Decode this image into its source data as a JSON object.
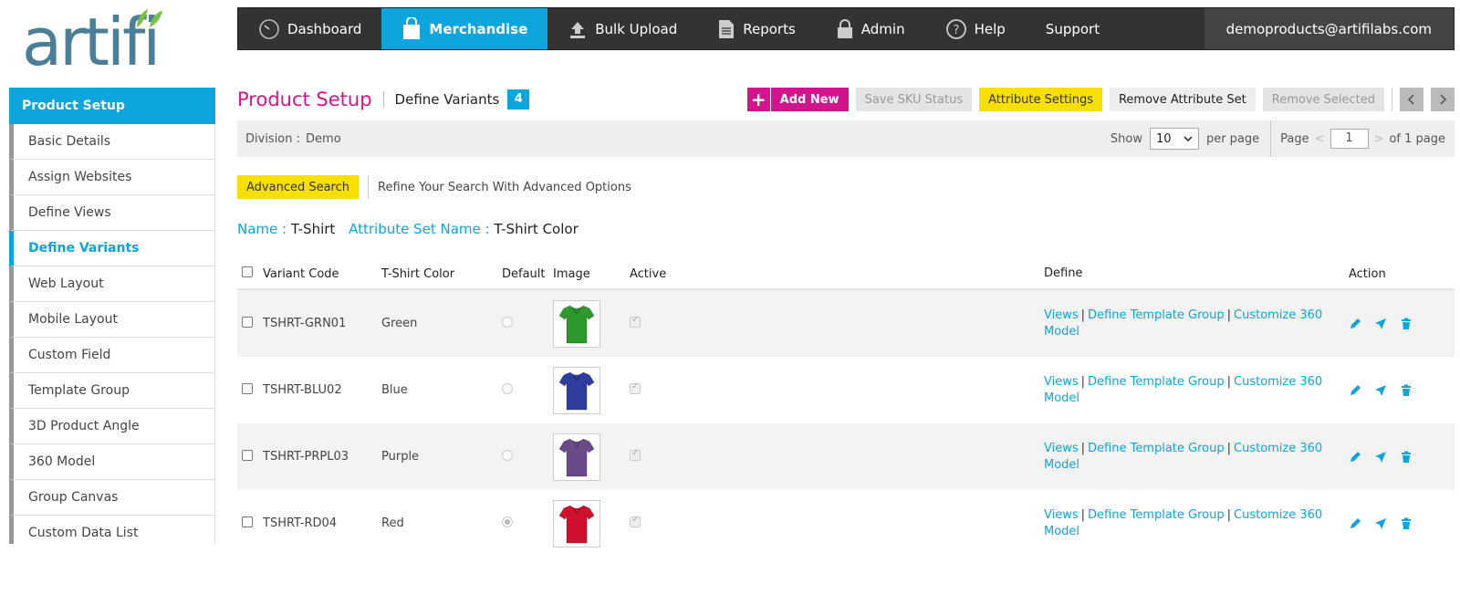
{
  "logo": {
    "text": "artifi"
  },
  "topnav": {
    "items": [
      {
        "label": "Dashboard",
        "icon": "gauge-icon"
      },
      {
        "label": "Merchandise",
        "icon": "shopping-bag-icon",
        "active": true
      },
      {
        "label": "Bulk Upload",
        "icon": "upload-icon"
      },
      {
        "label": "Reports",
        "icon": "document-icon"
      },
      {
        "label": "Admin",
        "icon": "lock-icon"
      },
      {
        "label": "Help",
        "icon": "help-circle-icon"
      },
      {
        "label": "Support",
        "icon": ""
      }
    ],
    "user": "demoproducts@artifilabs.com"
  },
  "sidebar": {
    "header": "Product Setup",
    "items": [
      {
        "label": "Basic Details"
      },
      {
        "label": "Assign Websites"
      },
      {
        "label": "Define Views"
      },
      {
        "label": "Define Variants",
        "active": true
      },
      {
        "label": "Web Layout"
      },
      {
        "label": "Mobile Layout"
      },
      {
        "label": "Custom Field"
      },
      {
        "label": "Template Group"
      },
      {
        "label": "3D Product Angle"
      },
      {
        "label": "360 Model"
      },
      {
        "label": "Group Canvas"
      },
      {
        "label": "Custom Data List"
      }
    ]
  },
  "header": {
    "title": "Product Setup",
    "subtitle": "Define Variants",
    "count": "4"
  },
  "toolbar": {
    "add_label": "Add New",
    "add_icon": "+",
    "save_sku_label": "Save SKU Status",
    "attribute_settings_label": "Attribute Settings",
    "remove_attribute_set_label": "Remove Attribute Set",
    "remove_selected_label": "Remove Selected"
  },
  "filter": {
    "division_label": "Division :",
    "division_value": "Demo",
    "show_label": "Show",
    "show_value": "10",
    "per_page_label": "per page",
    "page_label": "Page",
    "page_prev": "<",
    "page_value": "1",
    "page_next": ">",
    "page_total": "of 1 page"
  },
  "advanced": {
    "button_label": "Advanced Search",
    "description": "Refine Your Search With Advanced Options"
  },
  "info": {
    "name_label": "Name :",
    "name_value": "T-Shirt",
    "attr_label": "Attribute Set Name :",
    "attr_value": "T-Shirt Color"
  },
  "grid": {
    "columns": [
      "Variant Code",
      "T-Shirt Color",
      "Default",
      "Image",
      "Active",
      "Define",
      "Action"
    ],
    "rows": [
      {
        "code": "TSHRT-GRN01",
        "color": "Green",
        "default": false,
        "swatch": "#2e9a2e"
      },
      {
        "code": "TSHRT-BLU02",
        "color": "Blue",
        "default": false,
        "swatch": "#2f3e9e"
      },
      {
        "code": "TSHRT-PRPL03",
        "color": "Purple",
        "default": false,
        "swatch": "#6b4a8a"
      },
      {
        "code": "TSHRT-RD04",
        "color": "Red",
        "default": true,
        "swatch": "#d0102e"
      }
    ],
    "define_links": {
      "views": "Views",
      "template_group": "Define Template Group",
      "customize": "Customize 360",
      "customize_2": "Model"
    }
  },
  "colors": {
    "accent": "#0ea4dc",
    "brand_pink": "#d4148c",
    "highlight": "#f7e000"
  }
}
